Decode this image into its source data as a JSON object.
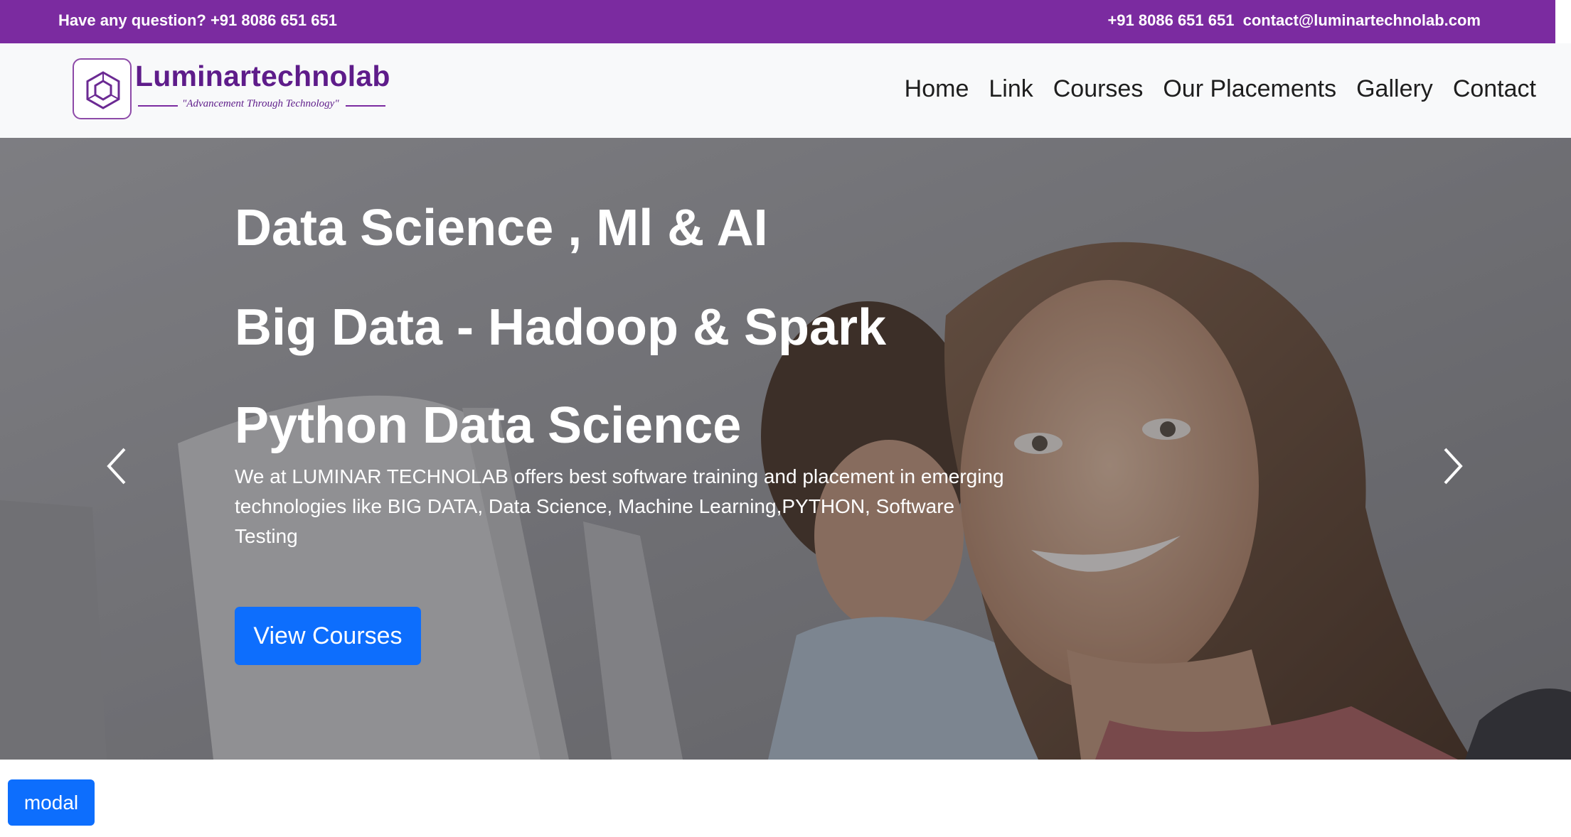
{
  "topbar": {
    "question": "Have any question? +91 8086 651 651",
    "phone": "+91 8086 651 651",
    "email": "contact@luminartechnolab.com"
  },
  "brand": {
    "name": "Luminartechnolab",
    "tagline": "\"Advancement Through Technology\"",
    "logo_icon": "hexagon-logo-icon"
  },
  "nav": {
    "items": [
      "Home",
      "Link",
      "Courses",
      "Our Placements",
      "Gallery",
      "Contact"
    ]
  },
  "hero": {
    "titles": [
      "Data Science , Ml & AI",
      "Big Data - Hadoop & Spark",
      "Python Data Science"
    ],
    "description": "We at LUMINAR TECHNOLAB offers best software training and placement in emerging technologies like BIG DATA, Data Science, Machine Learning,PYTHON, Software Testing",
    "cta_label": "View Courses",
    "prev_icon": "chevron-left-icon",
    "next_icon": "chevron-right-icon"
  },
  "modal_button": {
    "label": "modal"
  },
  "colors": {
    "topbar": "#7b2ba0",
    "brand": "#5e1c8a",
    "primary": "#0d6efd",
    "navbar_bg": "#f8f9fa"
  }
}
